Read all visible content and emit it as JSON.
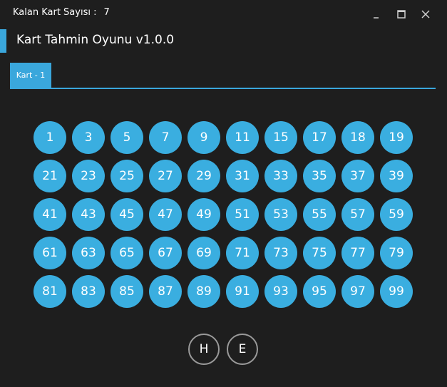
{
  "header": {
    "remaining_label": "Kalan Kart Sayısı :",
    "remaining_value": "7"
  },
  "window_controls": {
    "minimize_icon": "minimize-icon",
    "maximize_icon": "maximize-icon",
    "close_icon": "close-icon"
  },
  "app": {
    "title": "Kart Tahmin Oyunu v1.0.0",
    "accent_color": "#3aa7dc"
  },
  "tabs": [
    {
      "label": "Kart - 1",
      "active": true
    }
  ],
  "card_numbers": [
    "1",
    "3",
    "5",
    "7",
    "9",
    "11",
    "15",
    "17",
    "18",
    "19",
    "21",
    "23",
    "25",
    "27",
    "29",
    "31",
    "33",
    "35",
    "37",
    "39",
    "41",
    "43",
    "45",
    "47",
    "49",
    "51",
    "53",
    "55",
    "57",
    "59",
    "61",
    "63",
    "65",
    "67",
    "69",
    "71",
    "73",
    "75",
    "77",
    "79",
    "81",
    "83",
    "85",
    "87",
    "89",
    "91",
    "93",
    "95",
    "97",
    "99"
  ],
  "actions": {
    "no_label": "H",
    "yes_label": "E"
  }
}
